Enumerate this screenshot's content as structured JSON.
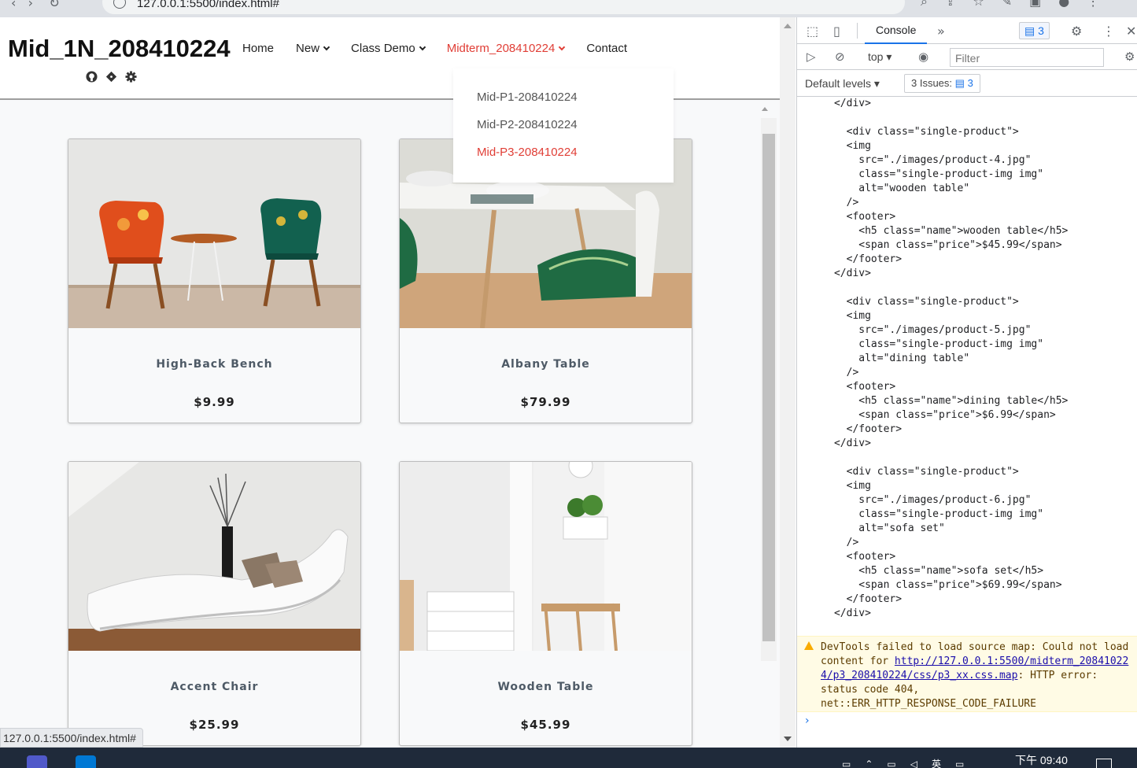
{
  "browser": {
    "url": "127.0.0.1:5500/index.html#",
    "status_url": "127.0.0.1:5500/index.html#"
  },
  "site": {
    "brand": "Mid_1N_208410224",
    "nav": [
      {
        "label": "Home",
        "dropdown": false
      },
      {
        "label": "New",
        "dropdown": true
      },
      {
        "label": "Class Demo",
        "dropdown": true
      },
      {
        "label": "Midterm_208410224",
        "dropdown": true,
        "active": true
      },
      {
        "label": "Contact",
        "dropdown": false
      }
    ],
    "dropdown_items": [
      {
        "label": "Mid-P1-208410224"
      },
      {
        "label": "Mid-P2-208410224"
      },
      {
        "label": "Mid-P3-208410224",
        "active": true
      }
    ],
    "social_icons": [
      "github-icon",
      "git-icon",
      "gear-icon"
    ],
    "accent_color": "#e03e36",
    "products": [
      {
        "name": "High-Back Bench",
        "price": "$9.99",
        "image": "chairs-photo"
      },
      {
        "name": "Albany Table",
        "price": "$79.99",
        "image": "dining-photo"
      },
      {
        "name": "Accent Chair",
        "price": "$25.99",
        "image": "chaise-photo"
      },
      {
        "name": "Wooden Table",
        "price": "$45.99",
        "image": "room-photo"
      }
    ]
  },
  "devtools": {
    "tab": "Console",
    "issues_badge": "3",
    "context": "top",
    "filter_placeholder": "Filter",
    "levels": "Default levels",
    "issues_label": "3 Issues:",
    "issues_count": "3",
    "code": "      </div>\n\n        <div class=\"single-product\">\n        <img\n          src=\"./images/product-4.jpg\"\n          class=\"single-product-img img\"\n          alt=\"wooden table\"\n        />\n        <footer>\n          <h5 class=\"name\">wooden table</h5>\n          <span class=\"price\">$45.99</span>\n        </footer>\n      </div>\n\n        <div class=\"single-product\">\n        <img\n          src=\"./images/product-5.jpg\"\n          class=\"single-product-img img\"\n          alt=\"dining table\"\n        />\n        <footer>\n          <h5 class=\"name\">dining table</h5>\n          <span class=\"price\">$6.99</span>\n        </footer>\n      </div>\n\n        <div class=\"single-product\">\n        <img\n          src=\"./images/product-6.jpg\"\n          class=\"single-product-img img\"\n          alt=\"sofa set\"\n        />\n        <footer>\n          <h5 class=\"name\">sofa set</h5>\n          <span class=\"price\">$69.99</span>\n        </footer>\n      </div>",
    "warning_text": "DevTools failed to load source map: Could not load content for ",
    "warning_link": "http://127.0.0.1:5500/midterm_208410224/p3_208410224/css/p3_xx.css.map",
    "warning_tail": ": HTTP error: status code 404, net::ERR_HTTP_RESPONSE_CODE_FAILURE"
  },
  "taskbar": {
    "clock": "下午 09:40"
  }
}
